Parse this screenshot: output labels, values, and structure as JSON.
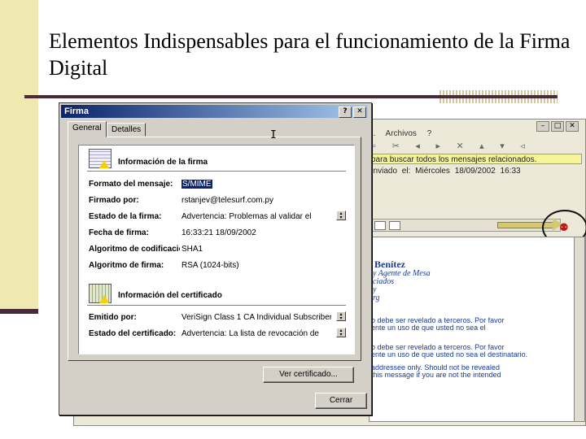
{
  "slide": {
    "title": "Elementos Indispensables para el funcionamiento de la Firma Digital"
  },
  "background_window": {
    "menu": "... Archivos ?",
    "info_bar": "para buscar todos los mensajes relacionados.",
    "from_line": "enviado el: Miércoles 18/09/2002 16:33",
    "sender_name": "Benítez",
    "sender_subtitle_1": "y Agente de Mesa",
    "sender_subtitle_2": "ciados",
    "sender_subtitle_3": "y",
    "sender_subtitle_4": "rg",
    "body_lines": [
      "o debe ser revelado a terceros. Por favor",
      "ente un uso de que usted no sea el",
      "o debe ser revelado a terceros. Por favor",
      "ente un uso de que usted no sea el destinatario.",
      "addressee only. Should not be revealed",
      "this message if you are not the intended"
    ],
    "seal_icon": "red-seal-icon"
  },
  "dialog": {
    "title": "Firma",
    "help_btn": "?",
    "close_btn": "✕",
    "tabs": [
      {
        "label": "General",
        "active": true
      },
      {
        "label": "Detalles",
        "active": false
      }
    ],
    "signature_section_title": "Información de la firma",
    "signature_fields": [
      {
        "label": "Formato del mensaje:",
        "value": "S/MIME",
        "selected": true
      },
      {
        "label": "Firmado por:",
        "value": "rstanjev@telesurf.com.py",
        "selected": false
      },
      {
        "label": "Estado de la firma:",
        "value": "Advertencia: Problemas al validar el",
        "selected": false,
        "spinner": true
      },
      {
        "label": "Fecha de firma:",
        "value": "16:33:21 18/09/2002",
        "selected": false
      },
      {
        "label": "Algoritmo de codificación:",
        "value": "SHA1",
        "selected": false
      },
      {
        "label": "Algoritmo de firma:",
        "value": "RSA (1024-bits)",
        "selected": false
      }
    ],
    "certificate_section_title": "Información del certificado",
    "certificate_fields": [
      {
        "label": "Emitido por:",
        "value": "VeriSign Class 1 CA Individual Subscriber-",
        "spinner": true
      },
      {
        "label": "Estado del certificado:",
        "value": "Advertencia: La lista de revocación de",
        "spinner": true
      }
    ],
    "view_cert_button": "Ver certificado...",
    "close_button": "Cerrar"
  },
  "colors": {
    "titlebar": "#0a246a",
    "dialog_bg": "#d4d0c8",
    "info_bar": "#f6f59a",
    "accent_band": "#efe9b0",
    "rule": "#4a2a3a"
  }
}
